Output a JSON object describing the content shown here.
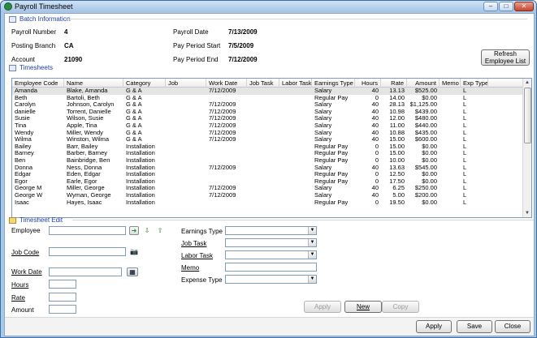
{
  "window": {
    "title": "Payroll Timesheet",
    "minimize": "–",
    "maximize": "□",
    "close": "✕"
  },
  "batch": {
    "section_title": "Batch Information",
    "payroll_number_label": "Payroll Number",
    "payroll_number": "4",
    "posting_branch_label": "Posting Branch",
    "posting_branch": "CA",
    "account_label": "Account",
    "account": "21090",
    "payroll_date_label": "Payroll Date",
    "payroll_date": "7/13/2009",
    "period_start_label": "Pay Period Start",
    "period_start": "7/5/2009",
    "period_end_label": "Pay Period End",
    "period_end": "7/12/2009",
    "refresh_line1": "Refresh",
    "refresh_line2": "Employee List"
  },
  "timesheets": {
    "section_title": "Timesheets",
    "columns": [
      "Employee Code",
      "Name",
      "Category",
      "Job",
      "Work Date",
      "Job Task",
      "Labor Task",
      "Earnings Type",
      "Hours",
      "Rate",
      "Amount",
      "Memo",
      "Exp Type"
    ],
    "rows": [
      [
        "Amanda",
        "Blake, Amanda",
        "G & A",
        "",
        "7/12/2009",
        "",
        "",
        "Salary",
        "40",
        "13.13",
        "$525.00",
        "",
        "L"
      ],
      [
        "Beth",
        "Bartoli, Beth",
        "G & A",
        "",
        "",
        "",
        "",
        "Regular Pay",
        "0",
        "14.00",
        "$0.00",
        "",
        "L"
      ],
      [
        "Carolyn",
        "Johnson, Carolyn",
        "G & A",
        "",
        "7/12/2009",
        "",
        "",
        "Salary",
        "40",
        "28.13",
        "$1,125.00",
        "",
        "L"
      ],
      [
        "danielle",
        "Torrent, Danielle",
        "G & A",
        "",
        "7/12/2009",
        "",
        "",
        "Salary",
        "40",
        "10.98",
        "$439.00",
        "",
        "L"
      ],
      [
        "Susie",
        "Wilson, Susie",
        "G & A",
        "",
        "7/12/2009",
        "",
        "",
        "Salary",
        "40",
        "12.00",
        "$480.00",
        "",
        "L"
      ],
      [
        "Tina",
        "Apple, Tina",
        "G & A",
        "",
        "7/12/2009",
        "",
        "",
        "Salary",
        "40",
        "11.00",
        "$440.00",
        "",
        "L"
      ],
      [
        "Wendy",
        "Miller, Wendy",
        "G & A",
        "",
        "7/12/2009",
        "",
        "",
        "Salary",
        "40",
        "10.88",
        "$435.00",
        "",
        "L"
      ],
      [
        "Wilma",
        "Winston, Wilma",
        "G & A",
        "",
        "7/12/2009",
        "",
        "",
        "Salary",
        "40",
        "15.00",
        "$600.00",
        "",
        "L"
      ],
      [
        "Bailey",
        "Barr, Bailey",
        "Installation",
        "",
        "",
        "",
        "",
        "Regular Pay",
        "0",
        "15.00",
        "$0.00",
        "",
        "L"
      ],
      [
        "Barney",
        "Barber, Barney",
        "Installation",
        "",
        "",
        "",
        "",
        "Regular Pay",
        "0",
        "15.00",
        "$0.00",
        "",
        "L"
      ],
      [
        "Ben",
        "Bainbridge, Ben",
        "Installation",
        "",
        "",
        "",
        "",
        "Regular Pay",
        "0",
        "10.00",
        "$0.00",
        "",
        "L"
      ],
      [
        "Donna",
        "Ness, Donna",
        "Installation",
        "",
        "7/12/2009",
        "",
        "",
        "Salary",
        "40",
        "13.63",
        "$545.00",
        "",
        "L"
      ],
      [
        "Edgar",
        "Eden, Edgar",
        "Installation",
        "",
        "",
        "",
        "",
        "Regular Pay",
        "0",
        "12.50",
        "$0.00",
        "",
        "L"
      ],
      [
        "Egor",
        "Earle, Egor",
        "Installation",
        "",
        "",
        "",
        "",
        "Regular Pay",
        "0",
        "17.50",
        "$0.00",
        "",
        "L"
      ],
      [
        "George M",
        "Miller, George",
        "Installation",
        "",
        "7/12/2009",
        "",
        "",
        "Salary",
        "40",
        "6.25",
        "$250.00",
        "",
        "L"
      ],
      [
        "George W",
        "Wyman, George",
        "Installation",
        "",
        "7/12/2009",
        "",
        "",
        "Salary",
        "40",
        "5.00",
        "$200.00",
        "",
        "L"
      ],
      [
        "Isaac",
        "Hayes, Isaac",
        "Installation",
        "",
        "",
        "",
        "",
        "Regular Pay",
        "0",
        "19.50",
        "$0.00",
        "",
        "L"
      ]
    ]
  },
  "edit": {
    "section_title": "Timesheet Edit",
    "employee_label": "Employee",
    "job_code_label": "Job Code",
    "work_date_label": "Work Date",
    "hours_label": "Hours",
    "rate_label": "Rate",
    "amount_label": "Amount",
    "earnings_type_label": "Earnings Type",
    "job_task_label": "Job Task",
    "labor_task_label": "Labor Task",
    "memo_label": "Memo",
    "expense_type_label": "Expense Type",
    "apply_label": "Apply",
    "new_label": "New",
    "copy_label": "Copy"
  },
  "footer": {
    "apply_label": "Apply",
    "save_label": "Save",
    "close_label": "Close"
  }
}
